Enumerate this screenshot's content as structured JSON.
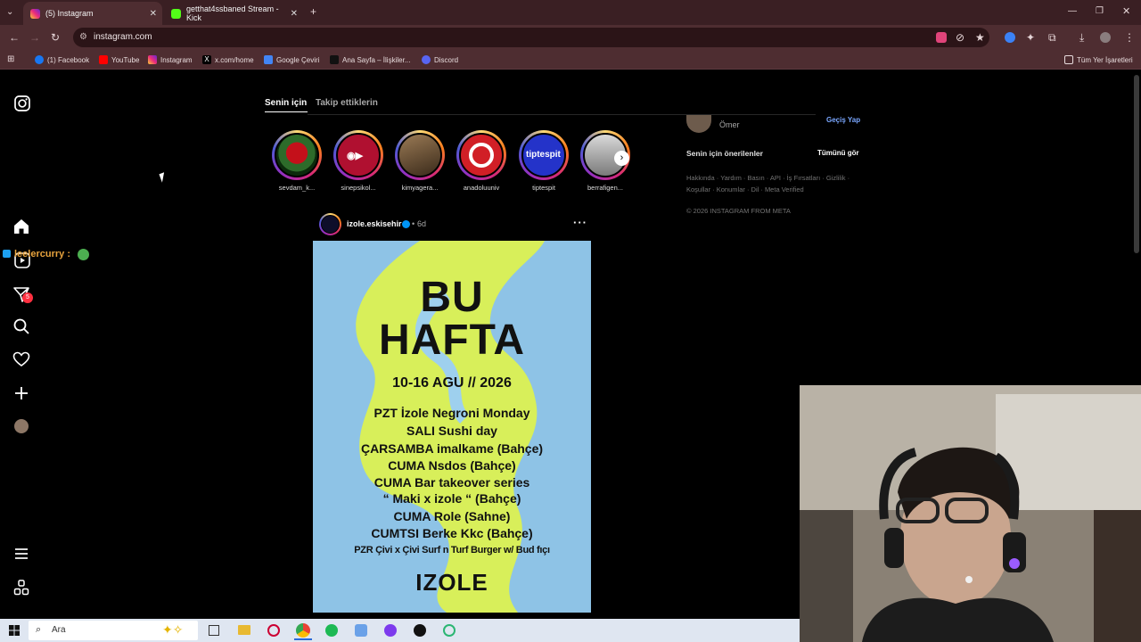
{
  "browser": {
    "tabs": [
      {
        "title": "(5) Instagram",
        "active": true
      },
      {
        "title": "getthat4ssbaned Stream - Kick",
        "active": false
      }
    ],
    "url": "instagram.com",
    "bookmarks": [
      {
        "label": "(1) Facebook"
      },
      {
        "label": "YouTube"
      },
      {
        "label": "Instagram"
      },
      {
        "label": "x.com/home"
      },
      {
        "label": "Google Çeviri"
      },
      {
        "label": "Ana Sayfa – İlişkiler..."
      },
      {
        "label": "Discord"
      }
    ],
    "all_bookmarks": "Tüm Yer İşaretleri"
  },
  "sidebar": {
    "messages_badge": "5",
    "overlay_name": "leelercurry :"
  },
  "feed": {
    "tab_for_you": "Senin için",
    "tab_following": "Takip ettiklerin",
    "stories": [
      {
        "name": "sevdam_k..."
      },
      {
        "name": "sinepsikol..."
      },
      {
        "name": "kimyagera..."
      },
      {
        "name": "anadoluuniv"
      },
      {
        "name": "tiptespit"
      },
      {
        "name": "berrafigen..."
      }
    ],
    "tiptespit_logo": "tiptespit",
    "post": {
      "username": "izole.eskisehir",
      "separator": "•",
      "time": "6d",
      "poster": {
        "line1": "BU",
        "line2": "HAFTA",
        "dates": "10-16 AGU  //  2026",
        "rows": [
          "PZT     İzole Negroni Monday",
          "SALI    Sushi day",
          "ÇARSAMBA   imalkame (Bahçe)",
          "CUMA    Nsdos (Bahçe)",
          "CUMA   Bar takeover series",
          "“ Maki x izole “ (Bahçe)",
          "CUMA   Role (Sahne)",
          "CUMTSI   Berke Kkc (Bahçe)",
          "PZR Çivi x Çivi Surf n Turf Burger w/ Bud fıçı"
        ],
        "brand": "IZOLE"
      }
    }
  },
  "right": {
    "profile_name": "Ömer",
    "switch": "Geçiş Yap",
    "suggestions": "Senin için önerilenler",
    "see_all": "Tümünü gör",
    "footer_line1": "Hakkında · Yardım · Basın · API · İş Fırsatları · Gizlilik ·",
    "footer_line2": "Koşullar · Konumlar · Dil · Meta Verified",
    "copyright": "© 2026 INSTAGRAM FROM META"
  },
  "taskbar": {
    "search_placeholder": "Ara"
  },
  "colors": {
    "instagram_link": "#7aa7ff",
    "badge": "#ff3040",
    "poster_bg": "#8ec3e6",
    "poster_green": "#d8ef5a"
  }
}
